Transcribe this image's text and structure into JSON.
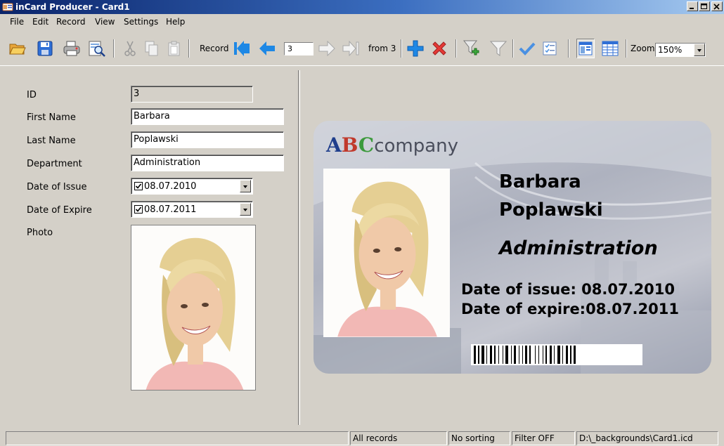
{
  "window": {
    "title": "inCard Producer - Card1"
  },
  "menu": [
    "File",
    "Edit",
    "Record",
    "View",
    "Settings",
    "Help"
  ],
  "toolbar": {
    "record_label": "Record",
    "record_value": "3",
    "from_label": "from 3",
    "zoom_label": "Zoom",
    "zoom_value": "150%"
  },
  "form": {
    "id": {
      "label": "ID",
      "value": "3"
    },
    "first_name": {
      "label": "First Name",
      "value": "Barbara"
    },
    "last_name": {
      "label": "Last Name",
      "value": "Poplawski"
    },
    "department": {
      "label": "Department",
      "value": "Administration"
    },
    "date_of_issue": {
      "label": "Date of Issue",
      "value": "08.07.2010",
      "checked": true
    },
    "date_of_expire": {
      "label": "Date of Expire",
      "value": "08.07.2011",
      "checked": true
    },
    "photo": {
      "label": "Photo"
    }
  },
  "card": {
    "logo_a": "A",
    "logo_b": "B",
    "logo_c": "C",
    "logo_company": "company",
    "first_name": "Barbara",
    "last_name": "Poplawski",
    "department": "Administration",
    "issue_line": "Date of issue:  08.07.2010",
    "expire_line": "Date of expire:08.07.2011"
  },
  "status": {
    "records": "All records",
    "sorting": "No sorting",
    "filter": "Filter OFF",
    "file": "D:\\_backgrounds\\Card1.icd"
  },
  "icons": {
    "open": "open-folder-icon",
    "save": "save-icon",
    "print": "print-icon",
    "preview": "print-preview-icon",
    "cut": "cut-icon",
    "copy": "copy-icon",
    "paste": "paste-icon",
    "first": "first-record-icon",
    "prev": "previous-record-icon",
    "next": "next-record-icon",
    "last": "last-record-icon",
    "add": "add-record-icon",
    "delete": "delete-record-icon",
    "filter_add": "add-filter-icon",
    "filter": "filter-icon",
    "check": "checkmark-icon",
    "checklist": "checklist-icon",
    "form_view": "form-view-icon",
    "table_view": "table-view-icon"
  },
  "colors": {
    "title_gradient_start": "#0a246a",
    "window_bg": "#d4d0c8",
    "nav_arrow": "#1e88e5",
    "add": "#1e88e5",
    "delete": "#e53935"
  }
}
